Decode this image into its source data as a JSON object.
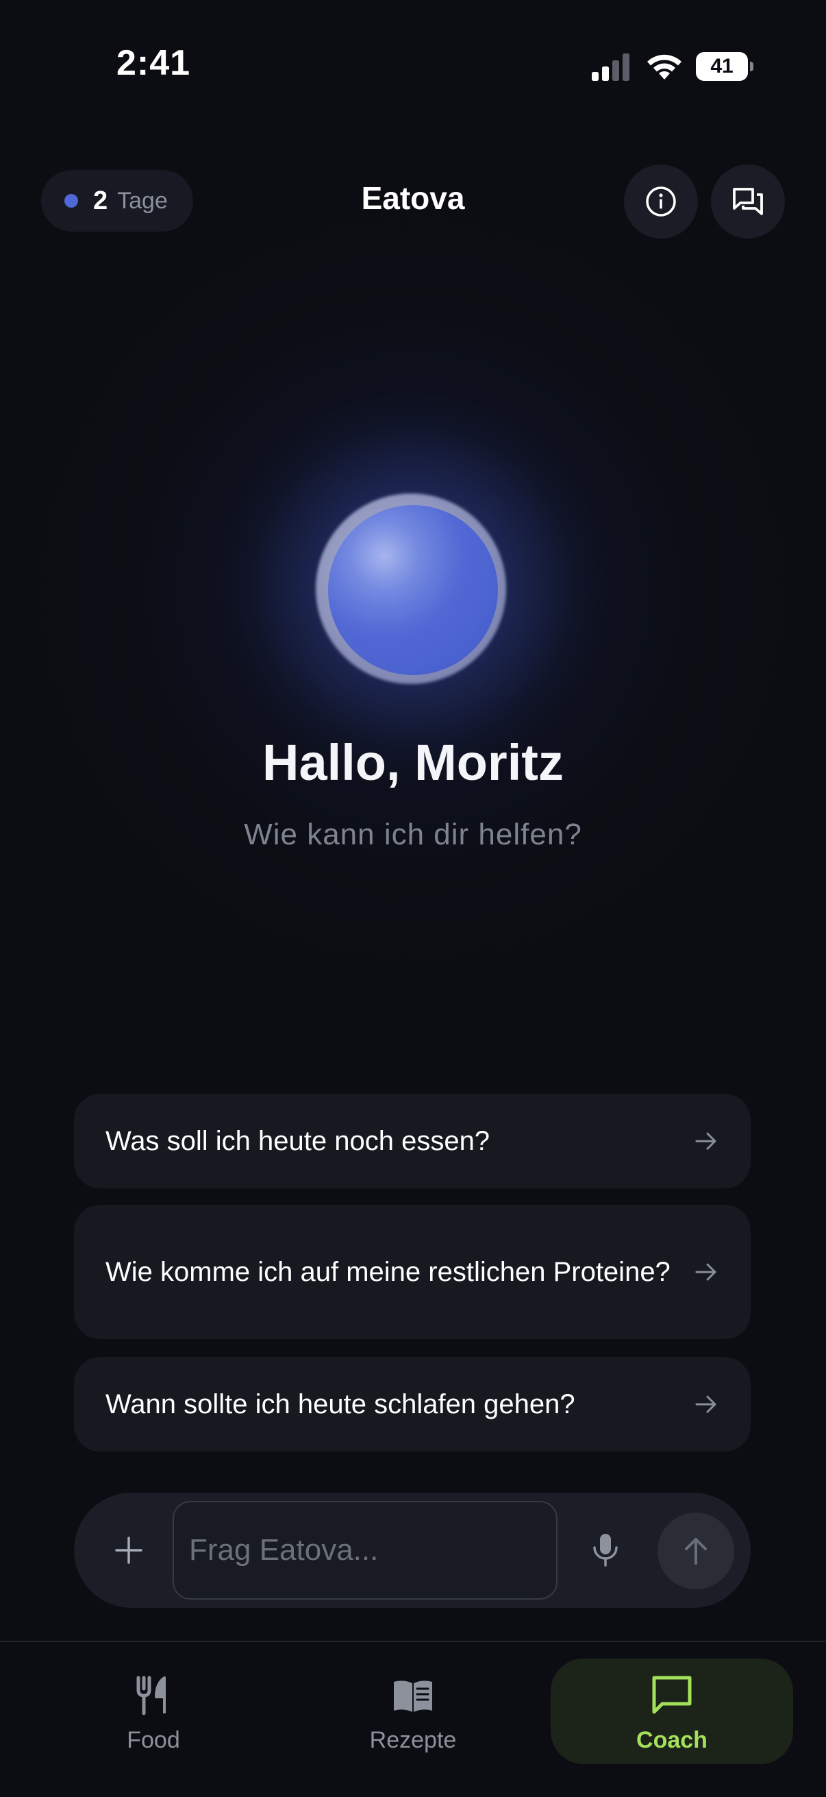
{
  "status_bar": {
    "time": "2:41",
    "battery": "41"
  },
  "header": {
    "streak_count": "2",
    "streak_label": "Tage",
    "title": "Eatova",
    "info_icon": "info-icon",
    "chats_icon": "chats-icon"
  },
  "hero": {
    "greeting": "Hallo, Moritz",
    "subtitle": "Wie kann ich dir helfen?"
  },
  "suggestions": [
    "Was soll ich heute noch essen?",
    "Wie komme ich auf meine restlichen Proteine?",
    "Wann sollte ich heute schlafen gehen?"
  ],
  "composer": {
    "placeholder": "Frag Eatova..."
  },
  "tabs": [
    {
      "label": "Food",
      "icon": "fork-knife-icon",
      "active": false
    },
    {
      "label": "Rezepte",
      "icon": "book-icon",
      "active": false
    },
    {
      "label": "Coach",
      "icon": "chat-bubble-icon",
      "active": true
    }
  ],
  "colors": {
    "background": "#0b0d12",
    "accent_blue": "#5068d8",
    "active_tab_text": "#a5e05a",
    "active_tab_bg": "#1c2319"
  }
}
